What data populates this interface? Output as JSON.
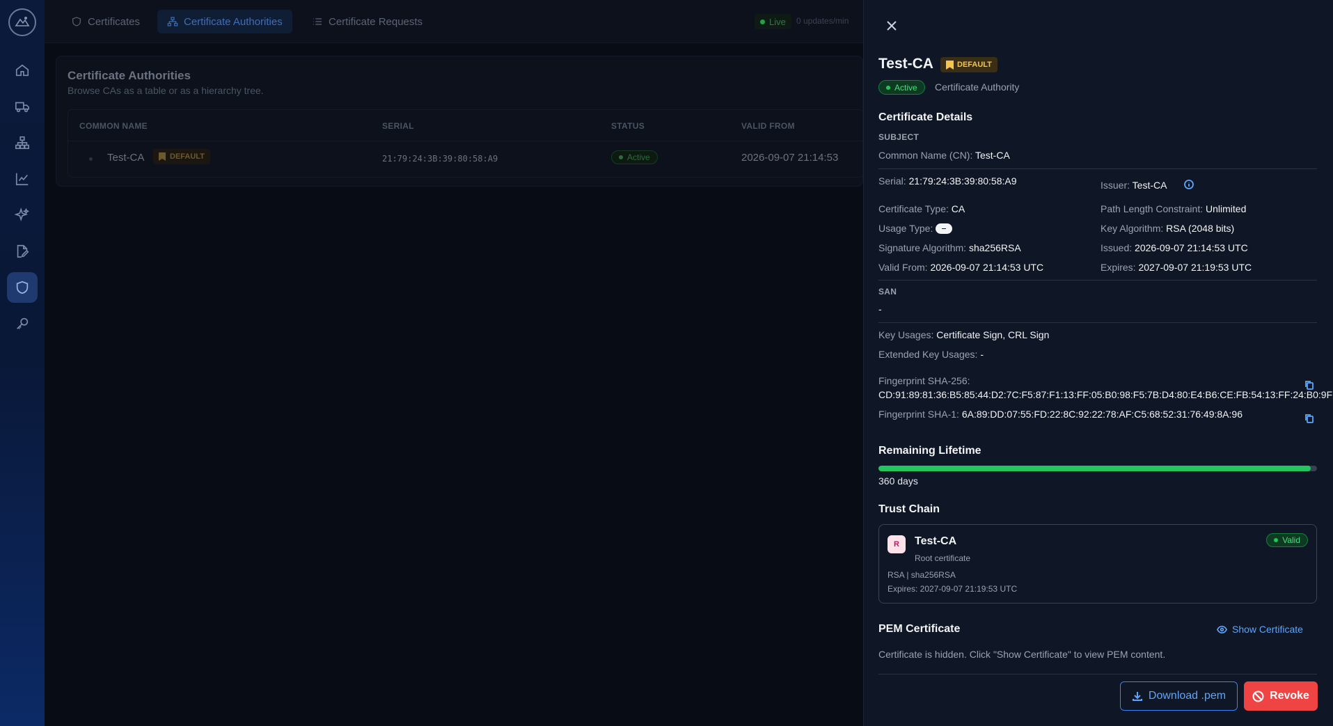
{
  "colors": {
    "accent": "#60a5fa",
    "success": "#22c55e",
    "danger": "#ef4444",
    "warning": "#f5c451",
    "drawer_bg": "#0f1625"
  },
  "sidebar": {
    "items": [
      {
        "icon": "home-icon"
      },
      {
        "icon": "truck-icon"
      },
      {
        "icon": "hierarchy-icon"
      },
      {
        "icon": "chart-icon"
      },
      {
        "icon": "sparkles-icon"
      },
      {
        "icon": "file-edit-icon"
      },
      {
        "icon": "shield-icon",
        "active": true
      },
      {
        "icon": "key-icon"
      }
    ]
  },
  "topbar": {
    "tabs": [
      {
        "label": "Certificates",
        "icon": "shield-icon"
      },
      {
        "label": "Certificate Authorities",
        "icon": "hierarchy-icon",
        "active": true
      },
      {
        "label": "Certificate Requests",
        "icon": "list-icon"
      }
    ],
    "live_label": "Live",
    "rate_label": "0 updates/min"
  },
  "ca_list": {
    "title": "Certificate Authorities",
    "subtitle": "Browse CAs as a table or as a hierarchy tree.",
    "columns": [
      "COMMON NAME",
      "SERIAL",
      "STATUS",
      "VALID FROM"
    ],
    "rows": [
      {
        "common_name": "Test-CA",
        "default_label": "DEFAULT",
        "serial": "21:79:24:3B:39:80:58:A9",
        "status": "Active",
        "valid_from": "2026-09-07 21:14:53"
      }
    ]
  },
  "drawer": {
    "title": "Test-CA",
    "default_label": "DEFAULT",
    "status": "Active",
    "type_label": "Certificate Authority",
    "details_heading": "Certificate Details",
    "subject_label": "SUBJECT",
    "cn_label": "Common Name (CN):",
    "cn_value": "Test-CA",
    "serial_label": "Serial:",
    "serial_value": "21:79:24:3B:39:80:58:A9",
    "issuer_label": "Issuer:",
    "issuer_value": "Test-CA",
    "cert_type_label": "Certificate Type:",
    "cert_type_value": "CA",
    "path_len_label": "Path Length Constraint:",
    "path_len_value": "Unlimited",
    "usage_type_label": "Usage Type:",
    "key_alg_label": "Key Algorithm:",
    "key_alg_value": "RSA (2048 bits)",
    "sig_alg_label": "Signature Algorithm:",
    "sig_alg_value": "sha256RSA",
    "issued_label": "Issued:",
    "issued_value": "2026-09-07 21:14:53 UTC",
    "valid_from_label": "Valid From:",
    "valid_from_value": "2026-09-07 21:14:53 UTC",
    "expires_label": "Expires:",
    "expires_value": "2027-09-07 21:19:53 UTC",
    "san_label": "SAN",
    "san_value": "-",
    "key_usages_label": "Key Usages:",
    "key_usages_value": "Certificate Sign, CRL Sign",
    "ext_key_usages_label": "Extended Key Usages:",
    "ext_key_usages_value": "-",
    "fp256_label": "Fingerprint SHA-256:",
    "fp256_value": "CD:91:89:81:36:B5:85:44:D2:7C:F5:87:F1:13:FF:05:B0:98:F5:7B:D4:80:E4:B6:CE:FB:54:13:FF:24:B0:9F",
    "fp1_label": "Fingerprint SHA-1:",
    "fp1_value": "6A:89:DD:07:55:FD:22:8C:92:22:78:AF:C5:68:52:31:76:49:8A:96",
    "lifetime_heading": "Remaining Lifetime",
    "lifetime_fraction": 0.986,
    "lifetime_days": "360 days",
    "trust_heading": "Trust Chain",
    "chain": {
      "badge": "R",
      "name": "Test-CA",
      "role": "Root certificate",
      "algo": "RSA | sha256RSA",
      "expires": "Expires: 2027-09-07 21:19:53 UTC",
      "status": "Valid"
    },
    "pem_heading": "PEM Certificate",
    "show_cert_label": "Show Certificate",
    "pem_note": "Certificate is hidden. Click \"Show Certificate\" to view PEM content.",
    "download_label": "Download .pem",
    "revoke_label": "Revoke"
  }
}
